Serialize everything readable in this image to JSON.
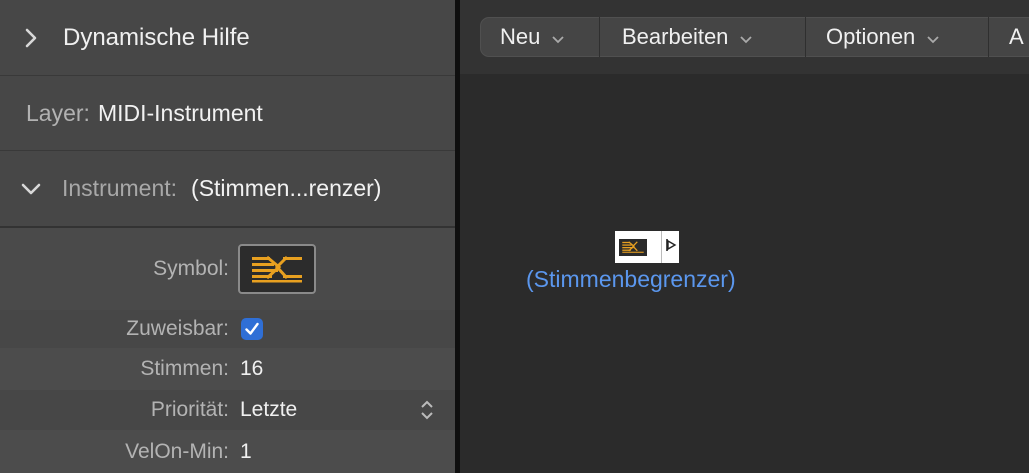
{
  "inspector": {
    "help_title": "Dynamische Hilfe",
    "layer_label": "Layer:",
    "layer_value": "MIDI-Instrument",
    "instrument_label": "Instrument:",
    "instrument_value": "(Stimmen...renzer)",
    "params": {
      "symbol_label": "Symbol:",
      "assignable_label": "Zuweisbar:",
      "assignable_checked": true,
      "voices_label": "Stimmen:",
      "voices_value": "16",
      "priority_label": "Priorität:",
      "priority_value": "Letzte",
      "velon_label": "VelOn-Min:",
      "velon_value": "1"
    }
  },
  "menubar": {
    "new": "Neu",
    "edit": "Bearbeiten",
    "options": "Optionen",
    "view_truncated": "A"
  },
  "canvas": {
    "object_name": "(Stimmenbegrenzer)"
  },
  "colors": {
    "accent_blue": "#2f6fd6",
    "object_name": "#5b97ee",
    "symbol_orange": "#e8a020"
  },
  "icons": {
    "help_toggle": "chevron-right-icon",
    "instrument_toggle": "chevron-down-icon",
    "symbol": "voice-limiter-icon",
    "menu_arrow": "chevron-down-icon",
    "priority_stepper": "up-down-stepper-icon",
    "output_port": "output-port-icon"
  }
}
